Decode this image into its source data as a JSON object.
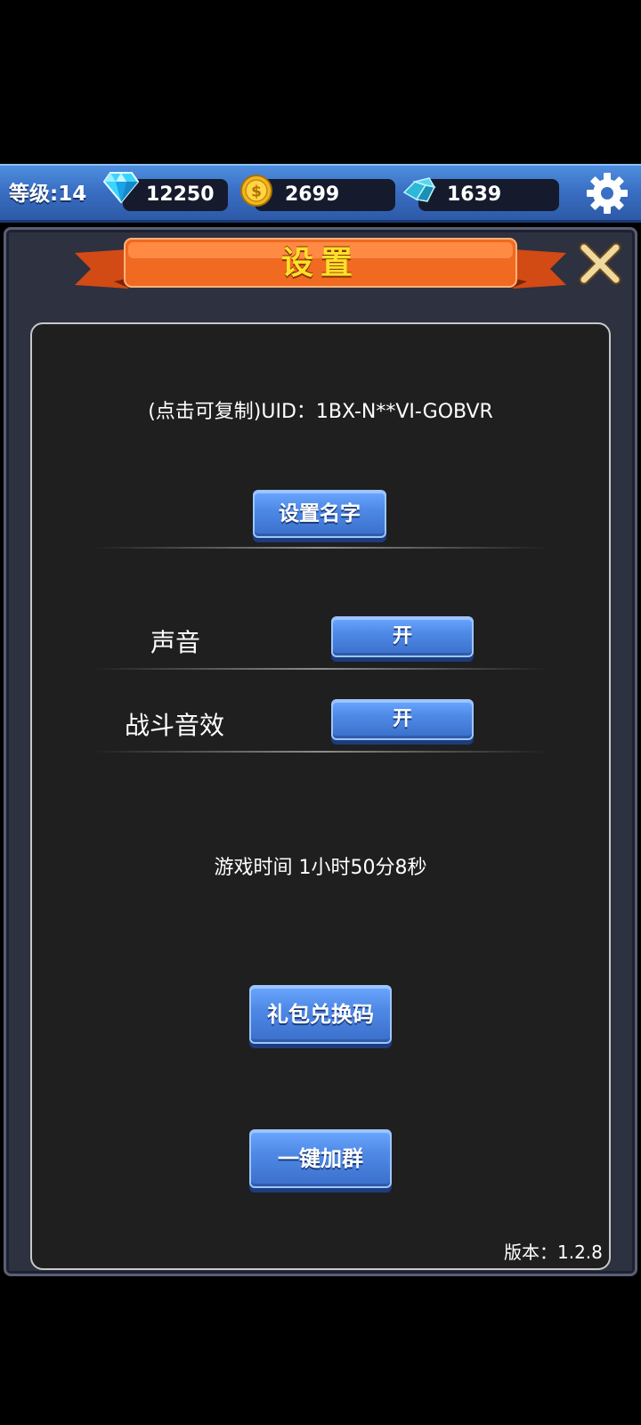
{
  "topbar": {
    "level_label": "等级:14",
    "diamonds": "12250",
    "gold": "2699",
    "crystals": "1639"
  },
  "icons": {
    "diamond": "diamond-icon",
    "gold": "gold-coin-icon",
    "crystal": "crystal-icon",
    "settings": "gear-icon",
    "close": "close-icon"
  },
  "dialog": {
    "title": "设置",
    "uid_text": "(点击可复制)UID：1BX-N**VI-GOBVR",
    "set_name_button": "设置名字",
    "sound_label": "声音",
    "sound_value": "开",
    "battle_sfx_label": "战斗音效",
    "battle_sfx_value": "开",
    "play_time": "游戏时间 1小时50分8秒",
    "gift_code_button": "礼包兑换码",
    "join_group_button": "一键加群",
    "version": "版本：1.2.8"
  },
  "colors": {
    "bar_blue": "#3a6fc4",
    "button_blue": "#4f89e6",
    "title_yellow": "#ffe02a",
    "ribbon_orange": "#f06a22",
    "panel_bg": "#1f1f1f"
  }
}
